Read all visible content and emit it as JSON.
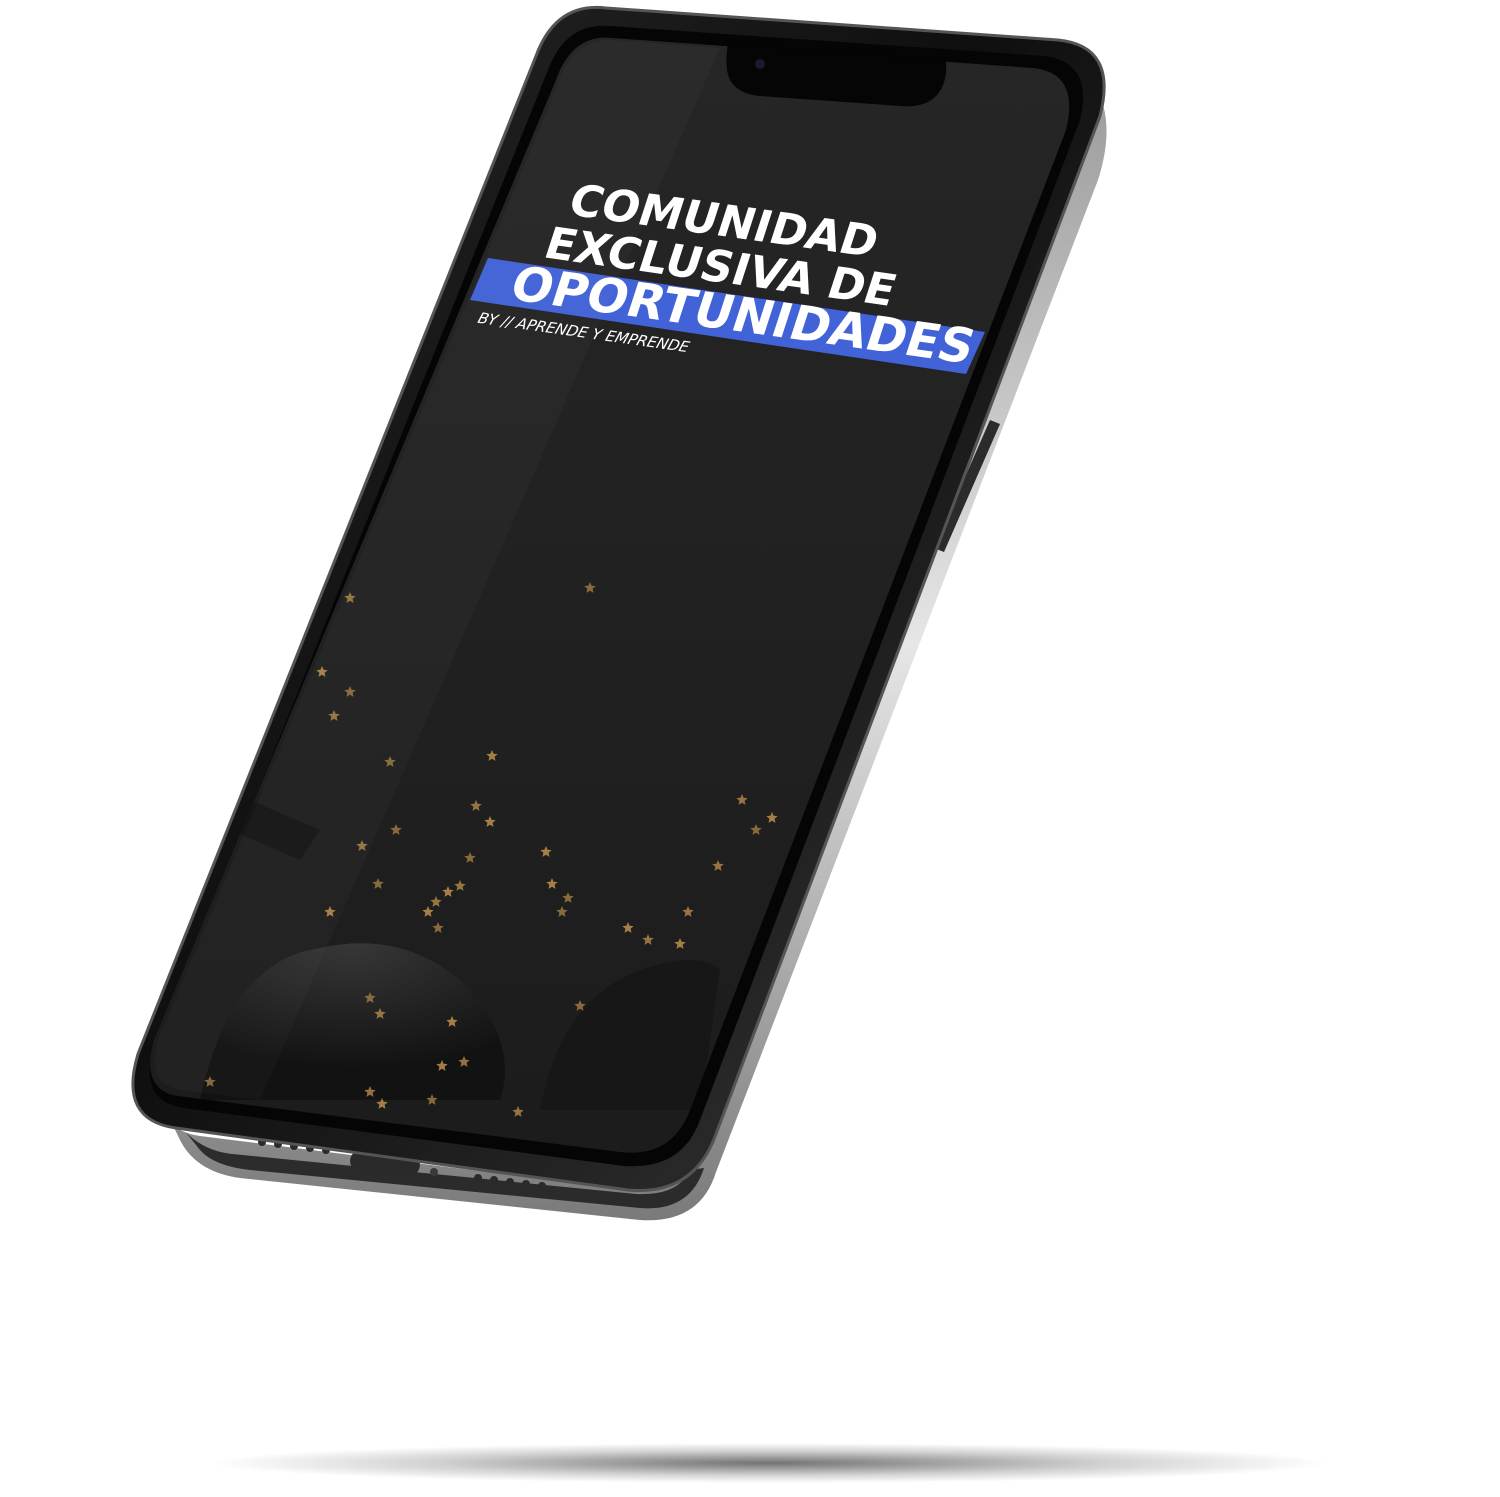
{
  "screen": {
    "headline_line1": "COMUNIDAD",
    "headline_line2": "EXCLUSIVA DE",
    "headline_highlight": "OPORTUNIDADES",
    "byline": "BY // APRENDE Y EMPRENDE"
  },
  "colors": {
    "highlight_band": "#4263d8",
    "screen_background": "#232323",
    "text": "#ffffff",
    "confetti": "#b58a4a",
    "frame": "#1b1b1b",
    "frame_edge": "#5a5a5a"
  },
  "icons": {
    "confetti": "star-icon"
  }
}
